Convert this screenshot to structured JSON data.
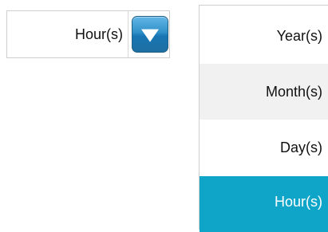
{
  "select": {
    "selected_value": "Hour(s)",
    "toggle_icon": "chevron-down-icon"
  },
  "dropdown": {
    "options": [
      {
        "label": "Year(s)"
      },
      {
        "label": "Month(s)"
      },
      {
        "label": "Day(s)"
      },
      {
        "label": "Hour(s)",
        "selected": true
      }
    ],
    "colors": {
      "hover_background": "#f1f1f1",
      "selected_background": "#0ea5c9",
      "selected_text": "#ffffff",
      "toggle_button": "#2f8fc8"
    }
  }
}
